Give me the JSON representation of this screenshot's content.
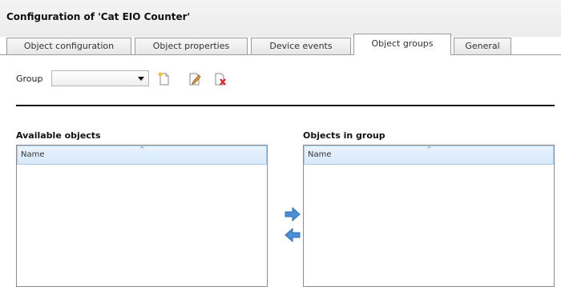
{
  "dialog": {
    "title": "Configuration of 'Cat EIO Counter'"
  },
  "tabs": [
    {
      "label": "Object configuration",
      "active": false
    },
    {
      "label": "Object properties",
      "active": false
    },
    {
      "label": "Device events",
      "active": false
    },
    {
      "label": "Object groups",
      "active": true
    },
    {
      "label": "General",
      "active": false
    }
  ],
  "group": {
    "label": "Group",
    "selected_value": ""
  },
  "toolbar": {
    "icons": [
      "new-icon",
      "edit-icon",
      "delete-icon"
    ]
  },
  "available_objects": {
    "title": "Available objects",
    "column_header": "Name",
    "rows": []
  },
  "objects_in_group": {
    "title": "Objects in group",
    "column_header": "Name",
    "rows": []
  },
  "transfer": {
    "icons": [
      "arrow-right-icon",
      "arrow-left-icon"
    ]
  },
  "colors": {
    "arrow_blue": "#4a90d9",
    "list_header_bg": "#d7e9fa",
    "divider": "#111111"
  }
}
